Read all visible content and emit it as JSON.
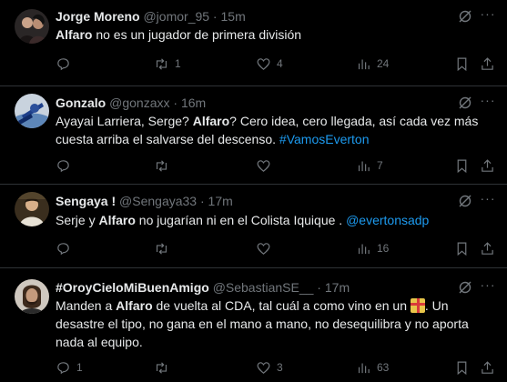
{
  "tweets": [
    {
      "name": "Jorge Moreno",
      "handle": "@jomor_95",
      "sep": " · ",
      "time": "15m",
      "segments": [
        {
          "t": "Alfaro",
          "style": "bold"
        },
        {
          "t": " no es un jugador de primera división",
          "style": "plain"
        }
      ],
      "replies": "",
      "retweets": "1",
      "likes": "4",
      "views": "24"
    },
    {
      "name": "Gonzalo",
      "handle": "@gonzaxx",
      "sep": " · ",
      "time": "16m",
      "segments": [
        {
          "t": "Ayayai Larriera, Serge? ",
          "style": "plain"
        },
        {
          "t": "Alfaro",
          "style": "bold"
        },
        {
          "t": "? Cero idea, cero llegada, así cada vez más cuesta arriba el salvarse del descenso. ",
          "style": "plain"
        },
        {
          "t": "#VamosEverton",
          "style": "link"
        }
      ],
      "replies": "",
      "retweets": "",
      "likes": "",
      "views": "7"
    },
    {
      "name": "Sengaya !",
      "handle": "@Sengaya33",
      "sep": " · ",
      "time": "17m",
      "segments": [
        {
          "t": "Serje y ",
          "style": "plain"
        },
        {
          "t": "Alfaro",
          "style": "bold"
        },
        {
          "t": " no jugarían ni en el Colista Iquique . ",
          "style": "plain"
        },
        {
          "t": "@evertonsadp",
          "style": "link"
        }
      ],
      "replies": "",
      "retweets": "",
      "likes": "",
      "views": "16"
    },
    {
      "name": "#OroyCieloMiBuenAmigo",
      "handle": "@SebastianSE__",
      "sep": " · ",
      "time": "17m",
      "segments": [
        {
          "t": "Manden a ",
          "style": "plain"
        },
        {
          "t": "Alfaro",
          "style": "bold"
        },
        {
          "t": " de vuelta al CDA, tal cuál a como vino en un ",
          "style": "plain"
        },
        {
          "t": "gift-emoji",
          "style": "emoji"
        },
        {
          "t": ". Un desastre el tipo, no gana en el mano a mano, no desequilibra y no aporta nada al equipo.",
          "style": "plain"
        }
      ],
      "replies": "1",
      "retweets": "",
      "likes": "3",
      "views": "63"
    }
  ],
  "icons": {
    "reply": "reply-icon",
    "retweet": "retweet-icon",
    "like": "heart-icon",
    "views": "views-icon",
    "bookmark": "bookmark-icon",
    "share": "share-icon",
    "grok": "grok-icon",
    "more": "more-icon"
  },
  "colors": {
    "background": "#000000",
    "text": "#e7e9ea",
    "muted": "#71767b",
    "link": "#1d9bf0",
    "divider": "#2f3336"
  }
}
